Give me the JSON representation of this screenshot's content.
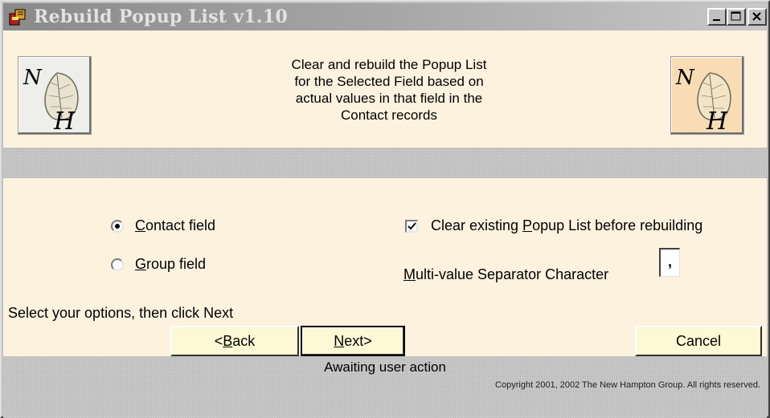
{
  "window": {
    "title": "Rebuild Popup List v1.10",
    "controls": {
      "minimize": "minimize",
      "maximize": "maximize",
      "close": "close"
    }
  },
  "header": {
    "description_lines": [
      "Clear and rebuild the Popup List",
      "for the Selected Field based on",
      "actual values in that field in the",
      "Contact records"
    ],
    "logo_letters": {
      "top": "N",
      "bottom": "H"
    }
  },
  "options": {
    "radio_contact": {
      "prefix": "",
      "accel": "C",
      "rest": "ontact field",
      "selected": true
    },
    "radio_group": {
      "prefix": "",
      "accel": "G",
      "rest": "roup field",
      "selected": false
    },
    "checkbox_clear": {
      "prefix": "Clear existing ",
      "accel": "P",
      "rest": "opup List before rebuilding",
      "checked": true
    },
    "separator_label": {
      "prefix": "",
      "accel": "M",
      "rest": "ulti-value Separator Character"
    },
    "separator_value": ","
  },
  "instruction": "Select your options, then click Next",
  "buttons": {
    "back": {
      "prefix": "<",
      "accel": "B",
      "rest": "ack"
    },
    "next": {
      "prefix": "",
      "accel": "N",
      "rest": "ext>"
    },
    "cancel": "Cancel"
  },
  "status": {
    "text": "Awaiting user action",
    "copyright": "Copyright 2001, 2002 The New Hampton Group.  All rights reserved."
  },
  "colors": {
    "panel_bg": "#fdf2dd",
    "button_bg": "#fff8d4",
    "chrome_gray": "#c0c0c0"
  }
}
